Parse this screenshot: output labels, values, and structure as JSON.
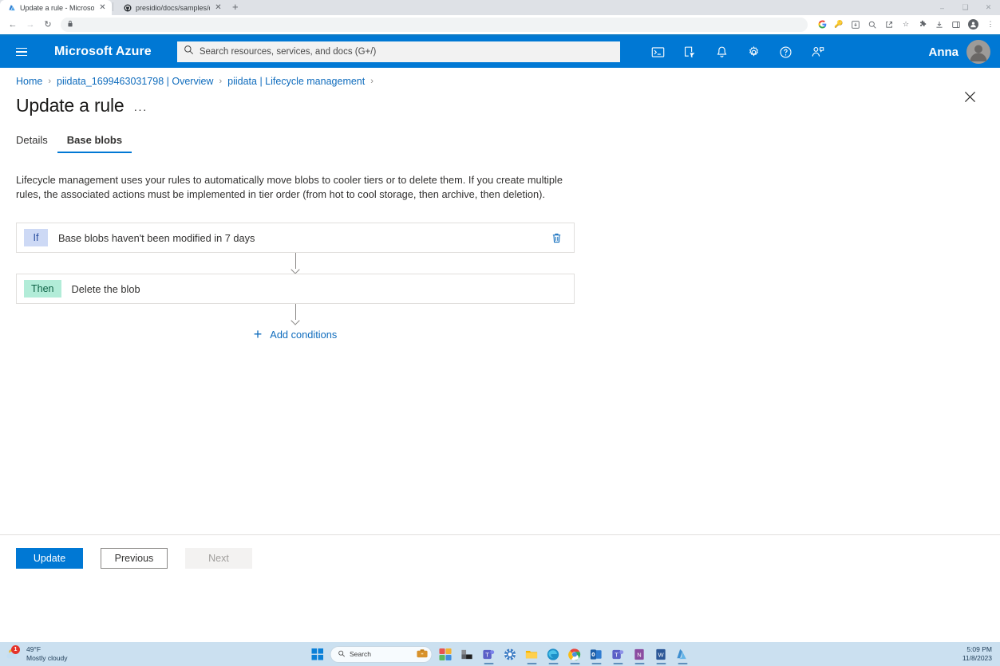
{
  "browser": {
    "tabs": [
      {
        "title": "Update a rule - Microsoft Azure",
        "favicon": "azure-icon",
        "active": true
      },
      {
        "title": "presidio/docs/samples/deploy",
        "favicon": "github-icon",
        "active": false
      }
    ],
    "new_tab_label": "+",
    "window_controls": {
      "minimize": "–",
      "maximize": "❑",
      "close": "✕"
    },
    "nav": {
      "back": "←",
      "forward": "→",
      "reload": "↻"
    },
    "omnibox": {
      "value": "",
      "placeholder": "",
      "lock_icon": "lock-icon"
    },
    "toolbar_icons": [
      "google-icon",
      "password-key-icon",
      "install-app-icon",
      "zoom-icon",
      "share-icon",
      "bookmark-star-icon",
      "extensions-icon",
      "downloads-icon",
      "side-panel-icon",
      "profile-icon",
      "chrome-menu-icon"
    ]
  },
  "azure_header": {
    "menu_label": "hamburger-menu",
    "brand": "Microsoft Azure",
    "search": {
      "value": "",
      "placeholder": "Search resources, services, and docs (G+/)"
    },
    "icons": [
      "cloud-shell-icon",
      "directories-subscriptions-icon",
      "notifications-bell-icon",
      "settings-gear-icon",
      "help-question-icon",
      "feedback-icon"
    ],
    "user_name": "Anna",
    "avatar": "user-avatar"
  },
  "breadcrumb": [
    {
      "label": "Home"
    },
    {
      "label": "piidata_1699463031798 | Overview"
    },
    {
      "label": "piidata | Lifecycle management"
    }
  ],
  "breadcrumb_separator": "›",
  "page": {
    "title": "Update a rule",
    "ellipsis": "···",
    "close_label": "✕"
  },
  "tabs": [
    {
      "label": "Details",
      "active": false
    },
    {
      "label": "Base blobs",
      "active": true
    }
  ],
  "description": "Lifecycle management uses your rules to automatically move blobs to cooler tiers or to delete them. If you create multiple rules, the associated actions must be implemented in tier order (from hot to cool storage, then archive, then deletion).",
  "rules": [
    {
      "badge": "If",
      "badge_type": "if",
      "text": "Base blobs haven't been modified in 7 days",
      "has_delete": true,
      "delete_icon": "trash-icon"
    },
    {
      "badge": "Then",
      "badge_type": "then",
      "text": "Delete the blob",
      "has_delete": false
    }
  ],
  "add_conditions": {
    "label": "Add conditions",
    "icon": "plus-icon"
  },
  "footer_buttons": [
    {
      "label": "Update",
      "style": "primary"
    },
    {
      "label": "Previous",
      "style": "secondary"
    },
    {
      "label": "Next",
      "style": "disabled"
    }
  ],
  "taskbar": {
    "weather": {
      "temperature": "49°F",
      "condition": "Mostly cloudy",
      "badge": "1",
      "icon": "cloud-sun-icon"
    },
    "start": "windows-start-icon",
    "search": {
      "placeholder": "Search",
      "icon": "search-icon"
    },
    "apps": [
      "widgets-icon",
      "visual-studio-icon",
      "teams-icon",
      "settings-icon",
      "file-explorer-icon",
      "edge-icon",
      "chrome-icon",
      "outlook-icon",
      "teams-chat-icon",
      "onenote-icon",
      "word-icon",
      "azure-storage-icon"
    ],
    "clock": {
      "time": "5:09 PM",
      "date": "11/8/2023"
    }
  },
  "colors": {
    "azure_blue": "#0078d4",
    "link_blue": "#0f6cbd",
    "if_badge_bg": "#cdd9f5",
    "then_badge_bg": "#b2ecd8",
    "taskbar_bg": "#cbe0f0"
  }
}
